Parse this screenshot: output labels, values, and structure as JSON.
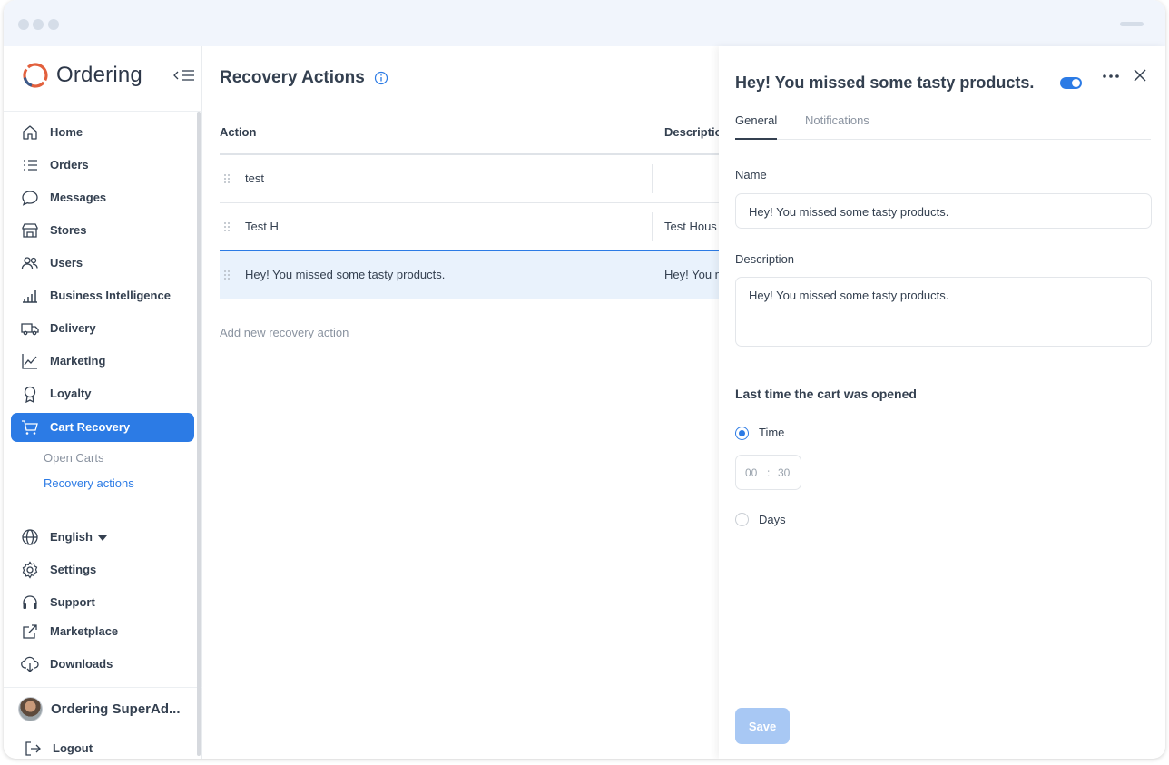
{
  "sidebar": {
    "logo_text": "Ordering",
    "nav": [
      {
        "label": "Home",
        "icon": "home-icon"
      },
      {
        "label": "Orders",
        "icon": "list-icon"
      },
      {
        "label": "Messages",
        "icon": "chat-bubble-icon"
      },
      {
        "label": "Stores",
        "icon": "store-icon"
      },
      {
        "label": "Users",
        "icon": "users-icon"
      },
      {
        "label": "Business Intelligence",
        "icon": "bar-chart-icon"
      },
      {
        "label": "Delivery",
        "icon": "truck-icon"
      },
      {
        "label": "Marketing",
        "icon": "line-chart-icon"
      },
      {
        "label": "Loyalty",
        "icon": "award-icon"
      },
      {
        "label": "Cart Recovery",
        "icon": "cart-icon",
        "active": true
      }
    ],
    "sub_items": [
      {
        "label": "Open Carts"
      },
      {
        "label": "Recovery actions",
        "active": true
      }
    ],
    "bottom": [
      {
        "label": "English",
        "icon": "globe-icon"
      },
      {
        "label": "Settings",
        "icon": "gear-icon"
      },
      {
        "label": "Support",
        "icon": "headset-icon"
      },
      {
        "label": "Marketplace",
        "icon": "external-link-icon"
      },
      {
        "label": "Downloads",
        "icon": "cloud-download-icon"
      }
    ],
    "user_name": "Ordering SuperAd...",
    "logout": "Logout"
  },
  "main": {
    "title": "Recovery Actions",
    "columns": {
      "action": "Action",
      "description": "Descriptio"
    },
    "rows": [
      {
        "action": "test",
        "description": ""
      },
      {
        "action": "Test H",
        "description": "Test Hous"
      },
      {
        "action": "Hey! You missed some tasty products.",
        "description": "Hey! You m",
        "selected": true
      }
    ],
    "add_link": "Add new recovery action"
  },
  "panel": {
    "title": "Hey! You missed some tasty products.",
    "enabled": true,
    "tabs": [
      {
        "label": "General",
        "active": true
      },
      {
        "label": "Notifications"
      }
    ],
    "name_label": "Name",
    "name_value": "Hey! You missed some tasty products.",
    "description_label": "Description",
    "description_value": "Hey! You missed some tasty products.",
    "section_title": "Last time the cart was opened",
    "option_time": "Time",
    "option_days": "Days",
    "time_hours": "00",
    "time_sep": ":",
    "time_minutes": "30",
    "save_label": "Save"
  },
  "colors": {
    "accent": "#2c7be5",
    "text": "#344050",
    "muted": "#8a93a0",
    "selected_row": "#e9f2fc",
    "save_disabled": "#a8c8f4"
  }
}
